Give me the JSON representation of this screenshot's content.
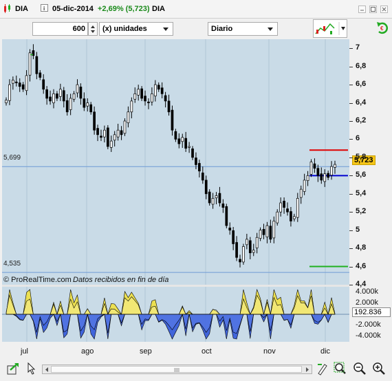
{
  "header": {
    "symbol": "DIA",
    "date": "05-dic-2014",
    "change": "+2,69% (5,723)",
    "symbol2": "DIA"
  },
  "toolbar": {
    "quantity": "600",
    "units_label": "(x) unidades",
    "period_label": "Diario"
  },
  "chart": {
    "watermark_brand": "© ProRealTime.com",
    "watermark_note": "Datos recibidos en fin de día",
    "level_high": "5,699",
    "level_low": "4,535",
    "price_badge": "5,723",
    "price_ticks": [
      "7",
      "6,8",
      "6,6",
      "6,4",
      "6,2",
      "6",
      "5,8",
      "5,6",
      "5,4",
      "5,2",
      "5",
      "4,8",
      "4,6",
      "4,4"
    ],
    "ind_ticks": [
      "4.000k",
      "2.000k",
      "-2.000k",
      "-4.000k"
    ],
    "ind_badge": "192.836",
    "x_labels": [
      "jul",
      "ago",
      "sep",
      "oct",
      "nov",
      "dic"
    ]
  },
  "chart_data": {
    "type": "candlestick",
    "ylim": [
      4.4,
      7.1
    ],
    "levels": [
      5.699,
      4.535
    ],
    "last_price": 5.723,
    "closes": [
      6.43,
      6.6,
      6.65,
      6.62,
      6.58,
      6.55,
      6.7,
      6.95,
      6.92,
      6.72,
      6.68,
      6.55,
      6.45,
      6.42,
      6.5,
      6.45,
      6.55,
      6.42,
      6.3,
      6.45,
      6.5,
      6.6,
      6.45,
      6.35,
      6.4,
      6.3,
      6.1,
      6.05,
      6.02,
      6.1,
      5.92,
      5.98,
      6.05,
      6.1,
      6.05,
      6.2,
      6.3,
      6.42,
      6.5,
      6.55,
      6.45,
      6.42,
      6.4,
      6.5,
      6.6,
      6.55,
      6.5,
      6.42,
      6.3,
      6.1,
      6.0,
      5.95,
      6.02,
      5.9,
      5.92,
      5.8,
      5.72,
      5.65,
      5.55,
      5.4,
      5.3,
      5.35,
      5.38,
      5.3,
      5.25,
      5.05,
      5.0,
      4.85,
      4.7,
      4.65,
      4.82,
      4.9,
      4.75,
      4.78,
      4.92,
      5.0,
      4.95,
      5.05,
      4.9,
      5.1,
      5.2,
      5.3,
      5.25,
      5.2,
      5.1,
      5.15,
      5.35,
      5.45,
      5.55,
      5.6,
      5.75,
      5.68,
      5.6,
      5.55,
      5.62,
      5.58,
      5.7,
      5.723
    ],
    "x_labels": [
      "jul",
      "ago",
      "sep",
      "oct",
      "nov",
      "dic"
    ],
    "indicator": {
      "ylim": [
        -5000,
        5000
      ],
      "last_value": 192.836,
      "ticks": [
        4000,
        2000,
        -2000,
        -4000
      ]
    }
  },
  "colors": {
    "chart_bg": "#c9dbe7",
    "up_candle": "#ffffff",
    "down_candle": "#000000",
    "level_line": "#6e9bd6",
    "red_line": "#e00000",
    "blue_line": "#0000d0",
    "green_line": "#20b020",
    "badge_bg": "#f5c518",
    "ind_yellow": "#f0e040",
    "ind_blue": "#2850d8",
    "change_green": "#1a8a1a"
  }
}
